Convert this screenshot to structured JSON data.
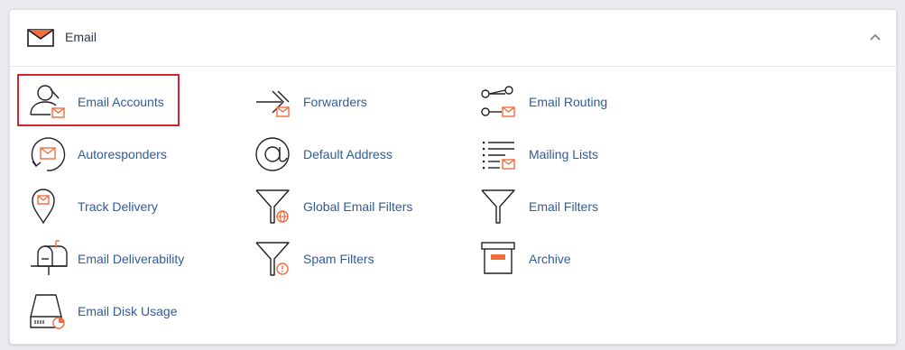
{
  "section": {
    "title": "Email",
    "collapse_icon": "chevron-up-icon",
    "header_icon": "envelope-icon"
  },
  "colors": {
    "accent": "#f26d3d",
    "link": "#2f5c9a",
    "highlight_border": "#d4252e"
  },
  "items": [
    {
      "label": "Email Accounts",
      "icon": "email-accounts-icon"
    },
    {
      "label": "Forwarders",
      "icon": "forwarders-icon"
    },
    {
      "label": "Email Routing",
      "icon": "email-routing-icon"
    },
    {
      "label": "Autoresponders",
      "icon": "autoresponders-icon"
    },
    {
      "label": "Default Address",
      "icon": "default-address-icon"
    },
    {
      "label": "Mailing Lists",
      "icon": "mailing-lists-icon"
    },
    {
      "label": "Track Delivery",
      "icon": "track-delivery-icon"
    },
    {
      "label": "Global Email Filters",
      "icon": "global-email-filters-icon"
    },
    {
      "label": "Email Filters",
      "icon": "email-filters-icon"
    },
    {
      "label": "Email Deliverability",
      "icon": "email-deliverability-icon"
    },
    {
      "label": "Spam Filters",
      "icon": "spam-filters-icon"
    },
    {
      "label": "Archive",
      "icon": "archive-icon"
    },
    {
      "label": "Email Disk Usage",
      "icon": "email-disk-usage-icon"
    }
  ]
}
